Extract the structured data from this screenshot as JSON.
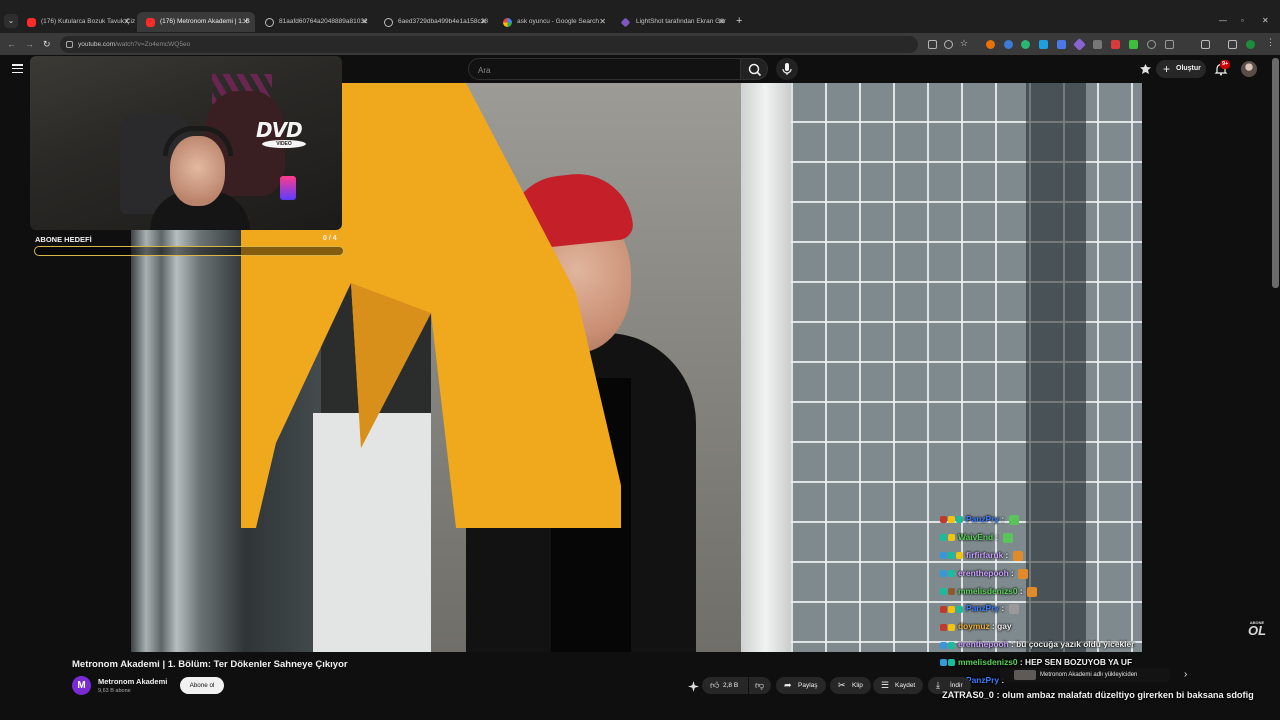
{
  "browser": {
    "tabs": [
      {
        "label": "(176) Kutularca Bozuk Tavuk Çiz",
        "icon": "youtube-icon",
        "active": false
      },
      {
        "label": "(176) Metronom Akademi | 1. B",
        "icon": "youtube-icon",
        "active": true
      },
      {
        "label": "81aafd60764a2048889a81032",
        "icon": "globe-icon",
        "active": false
      },
      {
        "label": "6aed3729dba499b4e1a158c28",
        "icon": "globe-icon",
        "active": false
      },
      {
        "label": "ask oyuncu - Google Search",
        "icon": "google-icon",
        "active": false
      },
      {
        "label": "LightShot tarafından Ekran Gör",
        "icon": "lightshot-icon",
        "active": false
      }
    ],
    "url_host": "youtube.com",
    "url_path": "/watch?v=Zo4emcWQ5eo"
  },
  "youtube": {
    "search_placeholder": "Ara",
    "create_label": "Oluştur",
    "notification_count": "9+"
  },
  "overlay": {
    "subscriber_goal_label": "ABONE HEDEFİ",
    "subscriber_goal_count": "0 / 4",
    "subscriber_goal_fraction": 0,
    "watermark_small": "ABONE",
    "watermark_big": "OL",
    "cam_logo": "DVD",
    "cam_logo_sub": "VIDEO"
  },
  "chat": [
    {
      "user": "PanzPry",
      "message": "",
      "user_color": "#3b7bff",
      "emote": "#5ac35a"
    },
    {
      "user": "WaivEnd",
      "message": "",
      "user_color": "#5ad15a",
      "emote": "#5ac35a"
    },
    {
      "user": "firfirfaruk",
      "message": "",
      "user_color": "#c8a0ff",
      "emote": "#e08a2a"
    },
    {
      "user": "erenthepooh",
      "message": "",
      "user_color": "#c8a0ff",
      "emote": "#e08a2a"
    },
    {
      "user": "mmelisdenizs0",
      "message": "",
      "user_color": "#5ad15a",
      "emote": "#e08a2a"
    },
    {
      "user": "PanzPry",
      "message": "",
      "user_color": "#3b7bff",
      "emote": "#9a9a9a"
    },
    {
      "user": "doymuz",
      "message": "gay",
      "user_color": "#f0b030",
      "emote": ""
    },
    {
      "user": "erenthepooh",
      "message": "bu çocuğa yazık oldu yicekler",
      "user_color": "#c8a0ff",
      "emote": ""
    },
    {
      "user": "mmelisdenizs0",
      "message": "HEP SEN BOZUYOB YA UF",
      "user_color": "#5ad15a",
      "emote": ""
    },
    {
      "user": "PanzPry",
      "message": "",
      "user_color": "#3b7bff",
      "emote": ""
    }
  ],
  "chat_bottom_line": "ZATRAS0_0 : olum ambaz malafatı düzeltiyo girerken bi baksana sdofig",
  "uploader_chip": "Metronom Akademi adlı yükleyiciden",
  "video": {
    "title": "Metronom Akademi | 1. Bölüm: Ter Dökenler Sahneye Çıkıyor",
    "channel_initial": "M",
    "channel": "Metronom Akademi",
    "subscribers": "9,63 B abone",
    "subscribe_label": "Abone ol",
    "likes": "2,8 B",
    "share_label": "Paylaş",
    "clip_label": "Klip",
    "save_label": "Kaydet",
    "download_label": "İndir"
  },
  "colors": {
    "accent_red": "#ff0000",
    "logo_yellow": "#f0a81c",
    "goal_gold": "#d9b54a"
  }
}
